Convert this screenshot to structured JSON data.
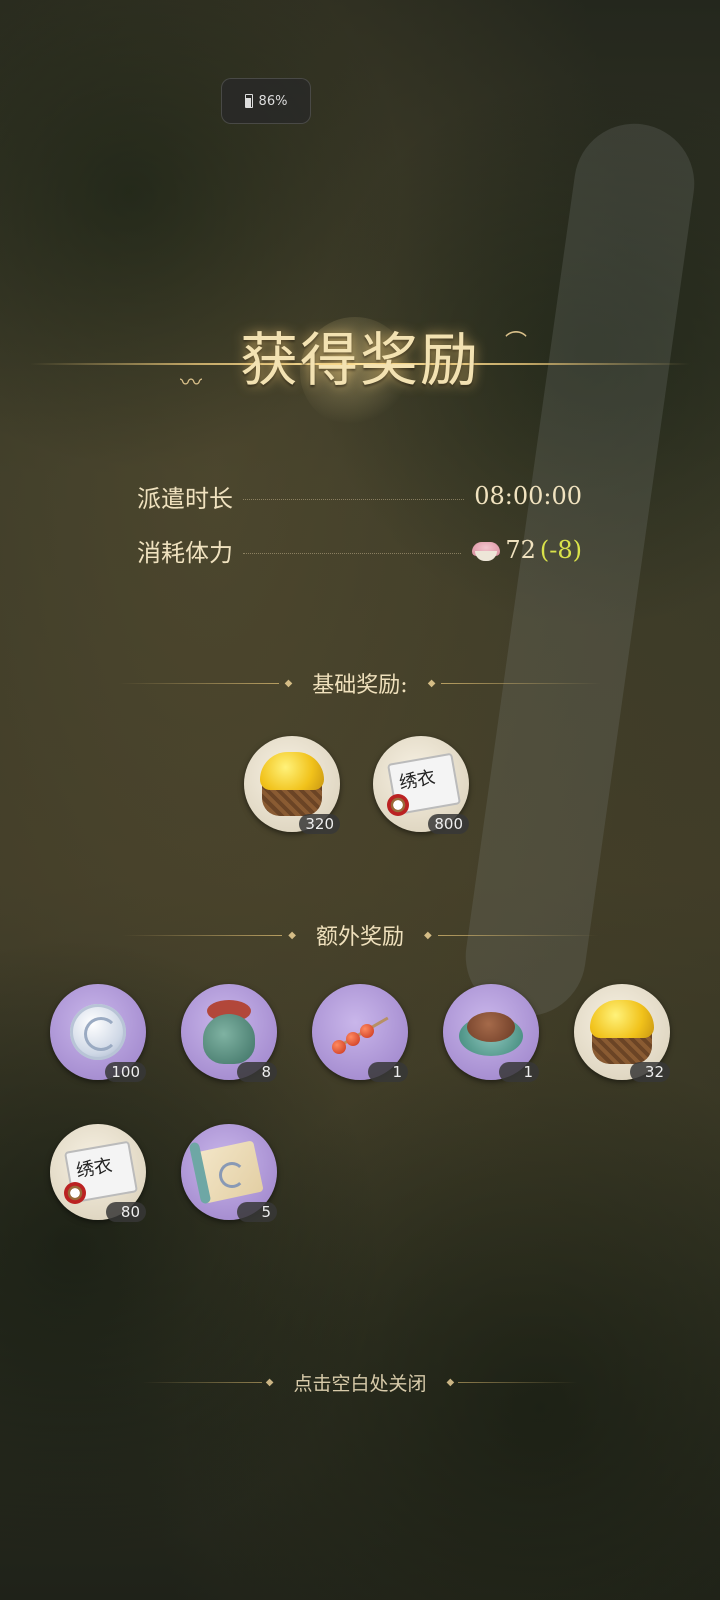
{
  "status_bar": {
    "battery": "86%"
  },
  "title": "获得奖励",
  "info": {
    "dispatch_label": "派遣时长",
    "dispatch_value": "08:00:00",
    "stamina_label": "消耗体力",
    "stamina_value": "72",
    "stamina_delta": "(-8)"
  },
  "sections": {
    "basic": "基础奖励:",
    "extra": "额外奖励"
  },
  "basic_rewards": [
    {
      "icon": "gold-basket-icon",
      "count": "320"
    },
    {
      "icon": "embroidery-scroll-icon",
      "count": "800"
    }
  ],
  "extra_rewards": [
    {
      "icon": "silver-disc-icon",
      "count": "100"
    },
    {
      "icon": "fruit-bag-icon",
      "count": "8"
    },
    {
      "icon": "skewer-icon",
      "count": "1"
    },
    {
      "icon": "meat-dish-icon",
      "count": "1"
    },
    {
      "icon": "gold-basket-icon",
      "count": "32"
    },
    {
      "icon": "embroidery-scroll-icon",
      "count": "80"
    },
    {
      "icon": "map-scroll-icon",
      "count": "5"
    }
  ],
  "scroll_text": "绣衣",
  "close_hint": "点击空白处关闭",
  "colors": {
    "accent": "#f3e2b2",
    "negative": "#d9e24a"
  }
}
